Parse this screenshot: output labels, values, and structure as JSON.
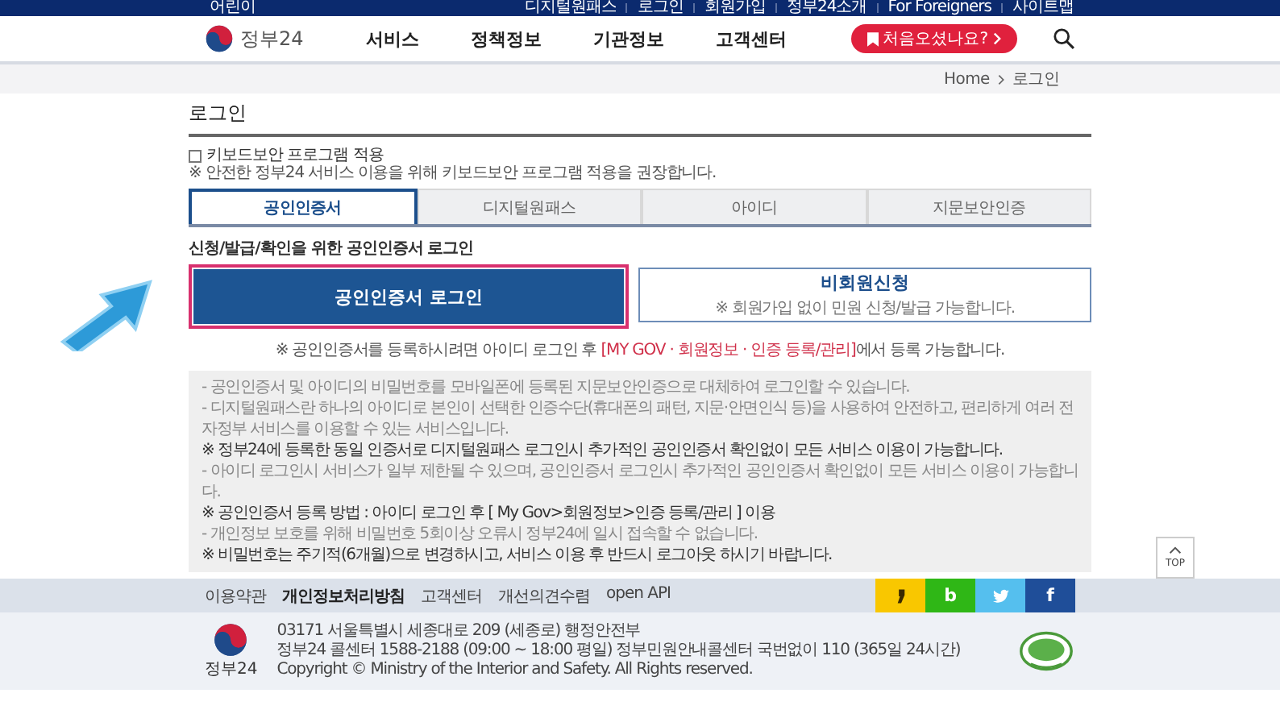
{
  "top_bar": {
    "left_link": "어린이",
    "links": [
      "디지털원패스",
      "로그인",
      "회원가입",
      "정부24소개",
      "For Foreigners",
      "사이트맵"
    ]
  },
  "header": {
    "logo_text": "정부24",
    "nav": [
      "서비스",
      "정책정보",
      "기관정보",
      "고객센터"
    ],
    "cta": "처음오셨나요?"
  },
  "breadcrumb": [
    "Home",
    "로그인"
  ],
  "page_title": "로그인",
  "keyboard_security": {
    "label": "키보드보안 프로그램 적용",
    "checked": false,
    "note": "※ 안전한 정부24 서비스 이용을 위해 키보드보안 프로그램 적용을 권장합니다."
  },
  "tabs": [
    {
      "label": "공인인증서",
      "selected": true
    },
    {
      "label": "디지털원패스",
      "selected": false
    },
    {
      "label": "아이디",
      "selected": false
    },
    {
      "label": "지문보안인증",
      "selected": false
    }
  ],
  "section_heading": "신청/발급/확인을 위한 공인인증서 로그인",
  "login_button": "공인인증서 로그인",
  "guest": {
    "title": "비회원신청",
    "note": "※ 회원가입 없이 민원 신청/발급 가능합니다."
  },
  "register_note": {
    "before": "※ 공인인증서를 등록하시려면 아이디 로그인 후",
    "link": "[MY GOV · 회원정보 · 인증 등록/관리]",
    "after": "에서 등록 가능합니다."
  },
  "info_lines": [
    {
      "kind": "bullet",
      "text": "- 공인인증서 및 아이디의 비밀번호를 모바일폰에 등록된 지문보안인증으로 대체하여 로그인할 수 있습니다."
    },
    {
      "kind": "bullet",
      "text": "- 디지털원패스란 하나의 아이디로 본인이 선택한 인증수단(휴대폰의 패턴, 지문·안면인식 등)을 사용하여 안전하고, 편리하게 여러 전자정부 서비스를 이용할 수 있는 서비스입니다."
    },
    {
      "kind": "note",
      "text": "※ 정부24에 등록한 동일 인증서로 디지털원패스 로그인시 추가적인 공인인증서 확인없이 모든 서비스 이용이 가능합니다."
    },
    {
      "kind": "bullet",
      "text": "- 아이디 로그인시 서비스가 일부 제한될 수 있으며, 공인인증서 로그인시 추가적인 공인인증서 확인없이 모든 서비스 이용이 가능합니다."
    },
    {
      "kind": "note",
      "text": "※ 공인인증서 등록 방법 : 아이디 로그인 후 [ My Gov>회원정보>인증 등록/관리 ] 이용"
    },
    {
      "kind": "bullet",
      "text": "- 개인정보 보호를 위해 비밀번호 5회이상 오류시 정부24에 일시 접속할 수 없습니다."
    },
    {
      "kind": "note",
      "text": "※ 비밀번호는 주기적(6개월)으로 변경하시고, 서비스 이용 후 반드시 로그아웃 하시기 바랍니다."
    }
  ],
  "top_button": "TOP",
  "footer_links": [
    {
      "label": "이용약관",
      "emphasized": false
    },
    {
      "label": "개인정보처리방침",
      "emphasized": true
    },
    {
      "label": "고객센터",
      "emphasized": false
    },
    {
      "label": "개선의견수렴",
      "emphasized": false
    },
    {
      "label": "open API",
      "emphasized": false
    }
  ],
  "social": [
    {
      "kind": "kakaostory",
      "color": "#f9c700"
    },
    {
      "kind": "band",
      "glyph": "b",
      "color": "#2fb716"
    },
    {
      "kind": "twitter",
      "color": "#55bfee"
    },
    {
      "kind": "facebook",
      "glyph": "f",
      "color": "#1f4e99"
    }
  ],
  "footer": {
    "logo_text": "정부24",
    "lines": [
      "03171 서울특별시 세종대로 209 (세종로) 행정안전부",
      "정부24 콜센터 1588-2188 (09:00 ~ 18:00 평일) 정부민원안내콜센터 국번없이 110 (365일 24시간)",
      "Copyright © Ministry of the Interior and Safety. All Rights reserved."
    ]
  }
}
